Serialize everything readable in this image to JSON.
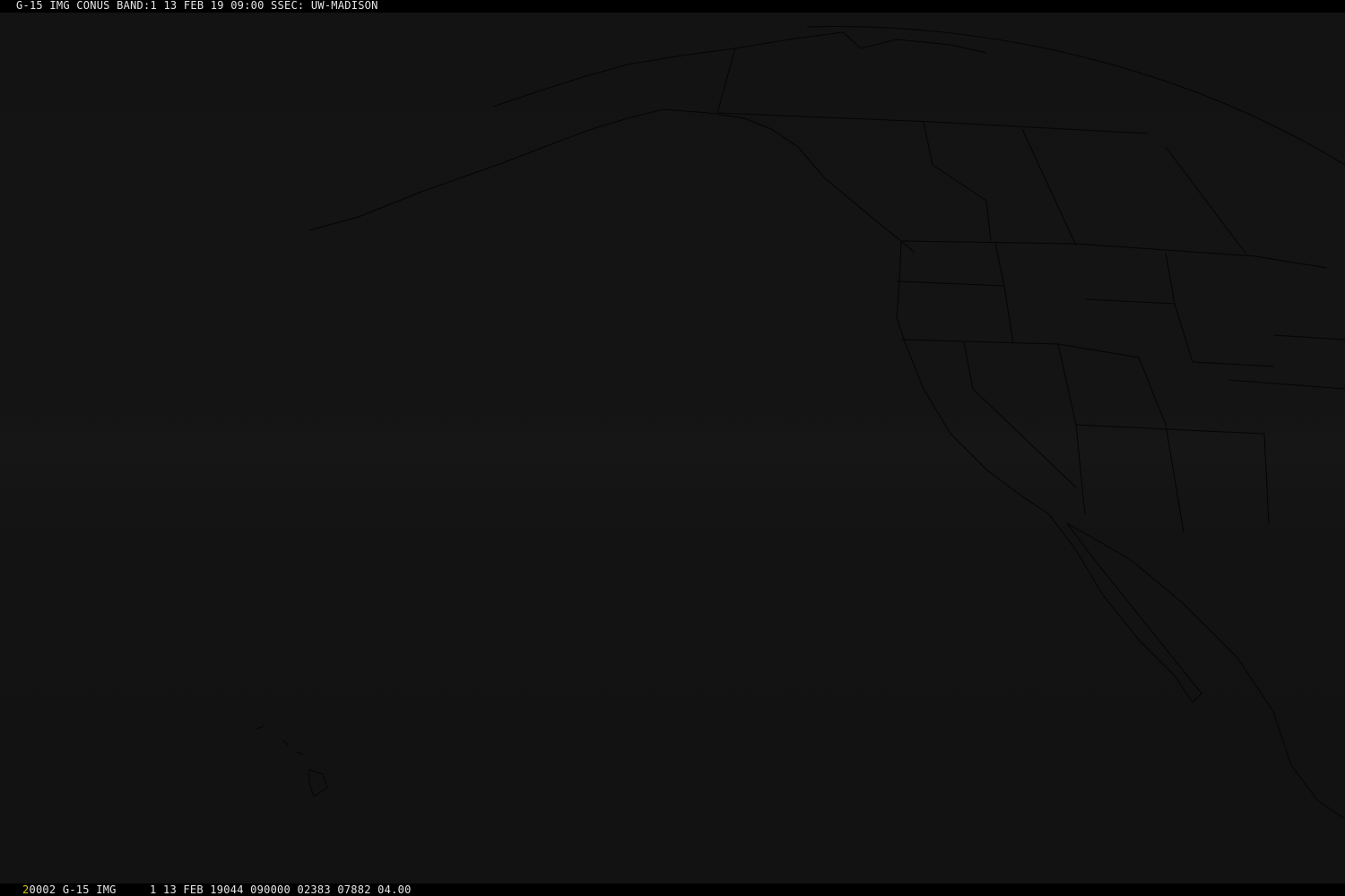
{
  "header": {
    "title": "G-15 IMG CONUS BAND:1 13 FEB 19 09:00 SSEC: UW-MADISON"
  },
  "footer": {
    "frame_number": "2",
    "info": "0002 G-15 IMG     1 13 FEB 19044 090000 02383 07882 04.00"
  },
  "colors": {
    "background": "#131313",
    "map_lines": "#050505",
    "text": "#e6e6e6",
    "frame_number": "#d9c200"
  }
}
